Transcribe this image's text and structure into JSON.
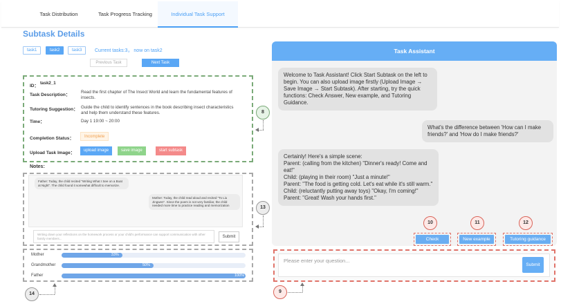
{
  "tabs": [
    {
      "label": "Task Distribution"
    },
    {
      "label": "Task Progress Tracking"
    },
    {
      "label": "Individual Task Support"
    }
  ],
  "subtask": {
    "title": "Subtask Details",
    "task_buttons": [
      "task1",
      "task2",
      "task3"
    ],
    "current_info": "Current tasks:3， now on task2",
    "prev_label": "Previous Task",
    "next_label": "Next Task"
  },
  "detail": {
    "id_label": "ID：",
    "id_value": "task2_1",
    "desc_label": "Task Description：",
    "desc_value": "Read the first chapter of The Insect World and learn the fundamental features of insects.",
    "tutor_label": "Tutoring Suggestion：",
    "tutor_value": "Guide the child to identify sentences in the book describing insect characteristics and help them understand these features.",
    "time_label": "Time：",
    "time_value": "Day 1  19:00 ~ 20:00",
    "status_label": "Completion Status：",
    "status_value": "Incomplete",
    "upload_label": "Upload Task Image：",
    "upload_btn": "upload image",
    "save_btn": "save image",
    "start_btn": "start subtask"
  },
  "notes": {
    "label": "Notes:",
    "messages": [
      "Father: Today, the child recited \"Writing What I See on a Boat at Night\". The child found it somewhat difficult to memorize.",
      "Mother: Today, the child read aloud and recited \"To Liu Jingwen\". Since the poem is not very familiar, the child needed more time to practice reading and memorization"
    ],
    "input_placeholder": "Writing down your reflections on the homework process or your child's performance can support communication with other family members...",
    "submit_label": "Submit"
  },
  "progress": [
    {
      "name": "Mother",
      "value": 33,
      "label": "33%"
    },
    {
      "name": "Grandmother",
      "value": 50,
      "label": "50%"
    },
    {
      "name": "Father",
      "value": 100,
      "label": "100%"
    }
  ],
  "assistant": {
    "title": "Task Assistant",
    "messages": [
      "Welcome to Task Assistant! Click Start Subtask on the left to begin. You can also upload image firstly (Upload Image → Save Image → Start Subtask). After starting, try the quick functions: Check Answer, New example, and Tutoring Guidance.",
      "What's the difference between 'How can I make friends?' and 'How do I make friends?'",
      "Certainly! Here's a simple scene:\nParent: (calling from the kitchen) \"Dinner's ready! Come and eat!\"\nChild: (playing in their room) \"Just a minute!\"\nParent: \"The food is getting cold. Let's eat while it's still warm.\"\nChild: (reluctantly putting away toys) \"Okay, I'm coming!\"\nParent: \"Great! Wash your hands first.\""
    ],
    "actions": [
      "Check answer",
      "New example",
      "Tutoring guidance"
    ],
    "input_placeholder": "Please enter your question...",
    "submit_label": "Submit"
  },
  "markers": {
    "m8": "8",
    "m9": "9",
    "m10": "10",
    "m11": "11",
    "m12": "12",
    "m13": "13",
    "m14": "14"
  }
}
